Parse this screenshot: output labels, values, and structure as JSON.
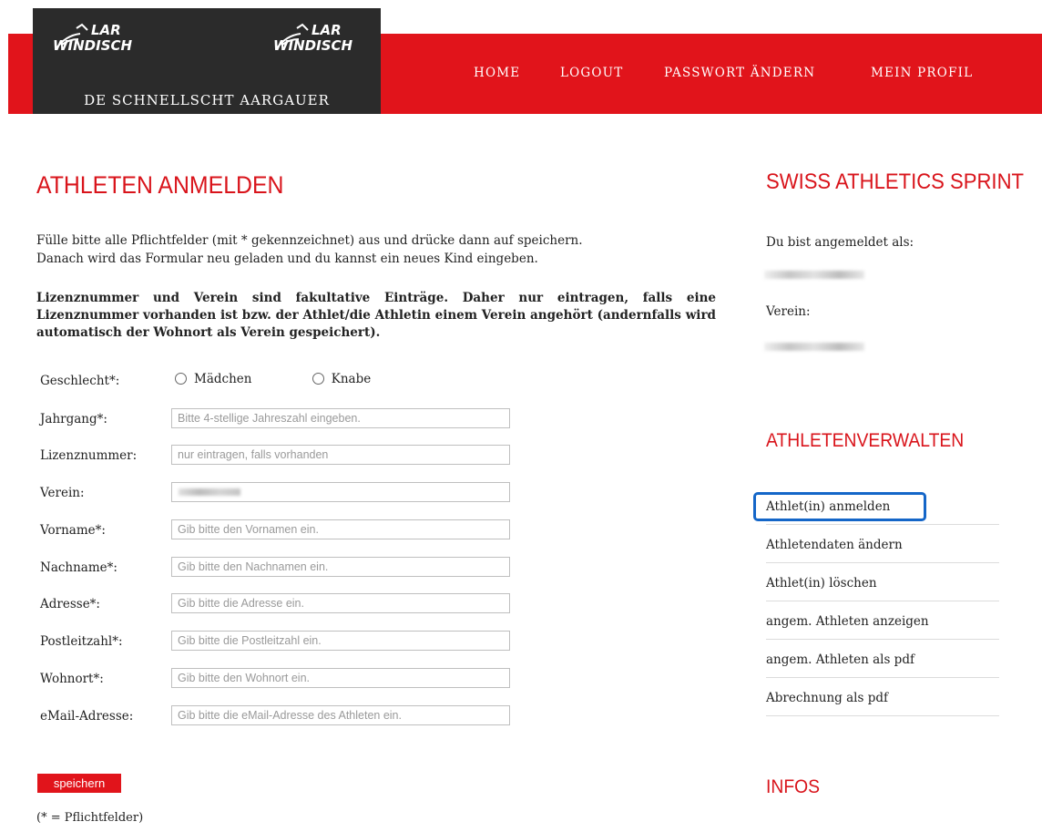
{
  "header": {
    "logo_line1": "LAR",
    "logo_line2": "WINDISCH",
    "tagline": "DE SCHNELLSCHT AARGAUER",
    "nav": [
      "HOME",
      "LOGOUT",
      "PASSWORT ÄNDERN",
      "MEIN PROFIL"
    ]
  },
  "main": {
    "title": "ATHLETEN ANMELDEN",
    "intro_1": "Fülle bitte alle Pflichtfelder (mit * gekennzeichnet) aus und drücke dann auf speichern.",
    "intro_2": "Danach wird das Formular neu geladen und du kannst ein neues Kind eingeben.",
    "note": "Lizenznummer und Verein sind fakultative Einträge. Daher nur eintragen, falls eine Lizenznummer vorhanden ist bzw. der Athlet/die Athletin einem Verein angehört (andernfalls wird automatisch der Wohnort als Verein gespeichert).",
    "gender_label": "Geschlecht*:",
    "gender_options": [
      "Mädchen",
      "Knabe"
    ],
    "fields": [
      {
        "label": "Jahrgang*:",
        "placeholder": "Bitte 4-stellige Jahreszahl eingeben."
      },
      {
        "label": "Lizenznummer:",
        "placeholder": "nur eintragen, falls vorhanden"
      },
      {
        "label": "Verein:",
        "placeholder": ""
      },
      {
        "label": "Vorname*:",
        "placeholder": "Gib bitte den Vornamen ein."
      },
      {
        "label": "Nachname*:",
        "placeholder": "Gib bitte den Nachnamen ein."
      },
      {
        "label": "Adresse*:",
        "placeholder": "Gib bitte die Adresse ein."
      },
      {
        "label": "Postleitzahl*:",
        "placeholder": "Gib bitte die Postleitzahl ein."
      },
      {
        "label": "Wohnort*:",
        "placeholder": "Gib bitte den Wohnort ein."
      },
      {
        "label": "eMail-Adresse:",
        "placeholder": "Gib bitte die eMail-Adresse des Athleten ein."
      }
    ],
    "save_label": "speichern",
    "footnote": "(* = Pflichtfelder)"
  },
  "sidebar": {
    "title": "SWISS ATHLETICS SPRINT",
    "logged_in_label": "Du bist angemeldet als:",
    "club_label": "Verein:",
    "manage_title": "ATHLETENVERWALTEN",
    "menu": [
      "Athlet(in) anmelden",
      "Athletendaten ändern",
      "Athlet(in) löschen",
      "angem. Athleten anzeigen",
      "angem. Athleten als pdf",
      "Abrechnung als pdf"
    ],
    "infos_title": "INFOS"
  },
  "colors": {
    "brand_red": "#e1141b",
    "dark": "#2b2b2b",
    "highlight": "#1466c8"
  }
}
